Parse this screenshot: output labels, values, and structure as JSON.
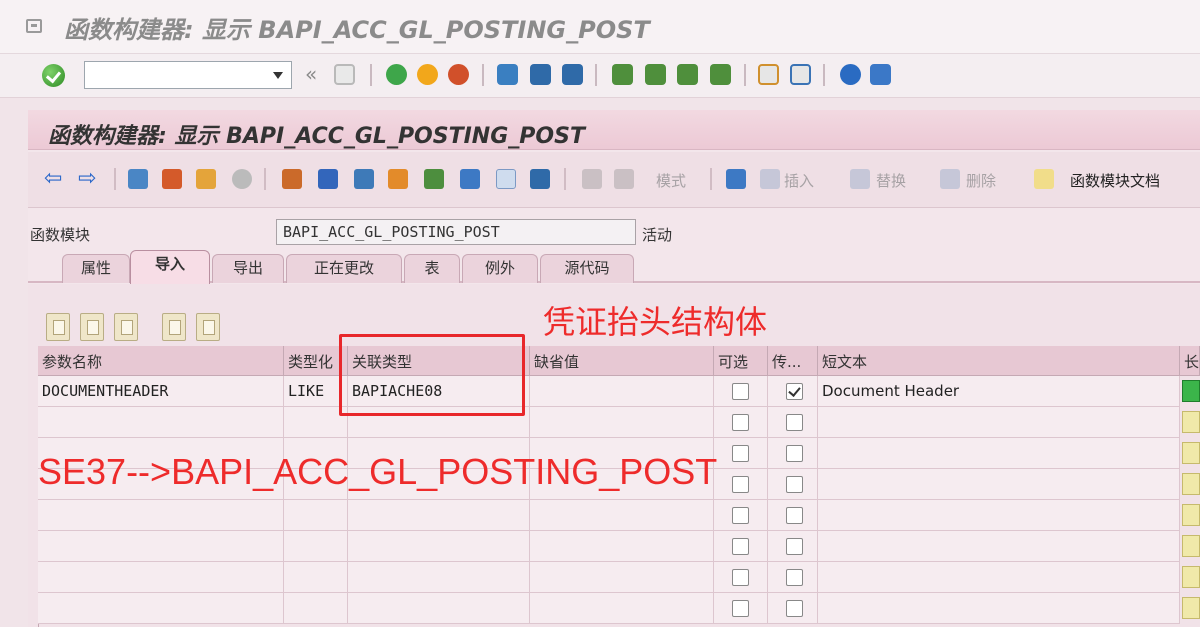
{
  "window": {
    "title": "函数构建器: 显示 BAPI_ACC_GL_POSTING_POST"
  },
  "system_toolbar": {
    "command_value": "",
    "icons": [
      "ok-icon",
      "save-icon",
      "back-icon",
      "exit-icon",
      "cancel-icon",
      "print-icon",
      "find-icon",
      "find-next-icon",
      "first-page-icon",
      "prev-page-icon",
      "next-page-icon",
      "last-page-icon",
      "new-session-icon",
      "shortcut-icon",
      "help-icon",
      "settings-icon"
    ]
  },
  "screen": {
    "title": "函数构建器: 显示 BAPI_ACC_GL_POSTING_POST"
  },
  "app_toolbar": {
    "mode_label": "模式",
    "insert_label": "插入",
    "replace_label": "替换",
    "delete_label": "删除",
    "doc_label": "函数模块文档"
  },
  "function_module": {
    "label": "函数模块",
    "value": "BAPI_ACC_GL_POSTING_POST",
    "status": "活动"
  },
  "tabs": [
    {
      "label": "属性",
      "active": false
    },
    {
      "label": "导入",
      "active": true
    },
    {
      "label": "导出",
      "active": false
    },
    {
      "label": "正在更改",
      "active": false
    },
    {
      "label": "表",
      "active": false
    },
    {
      "label": "例外",
      "active": false
    },
    {
      "label": "源代码",
      "active": false
    }
  ],
  "table": {
    "headers": [
      "参数名称",
      "类型化",
      "关联类型",
      "缺省值",
      "可选",
      "传...",
      "短文本",
      "长"
    ],
    "rows": [
      {
        "param": "DOCUMENTHEADER",
        "typing": "LIKE",
        "assoc_type": "BAPIACHE08",
        "default": "",
        "optional": false,
        "pass_value": true,
        "short_text": "Document Header"
      }
    ],
    "empty_rows": 7
  },
  "annotations": {
    "label_1": "凭证抬头结构体",
    "label_2": "SE37-->BAPI_ACC_GL_POSTING_POST"
  },
  "colors": {
    "accent_red": "#ee2b2b",
    "header_pink": "#e7c8d3",
    "ok_green": "#2d8a24"
  }
}
